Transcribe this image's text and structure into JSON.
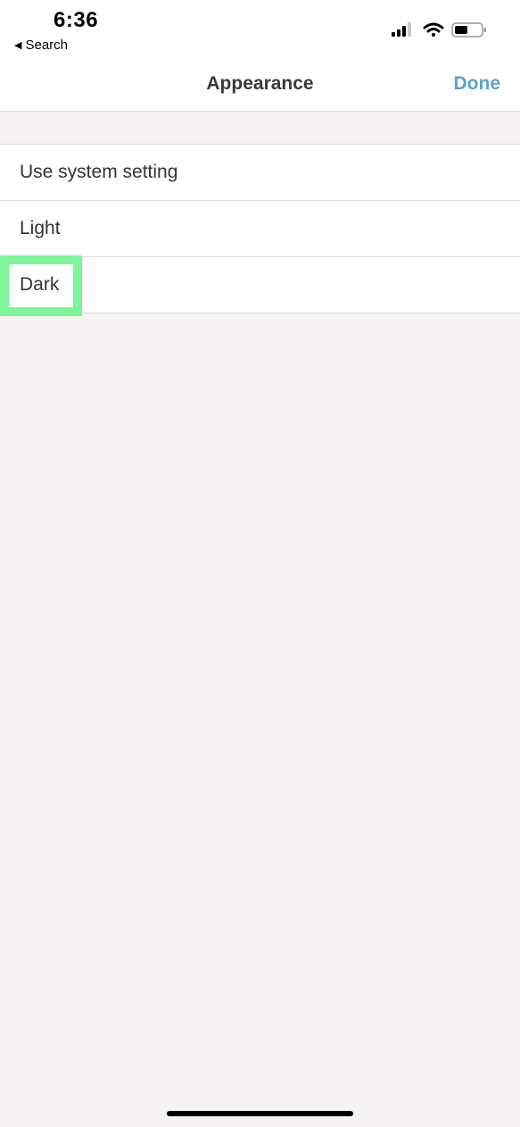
{
  "status_bar": {
    "time": "6:36",
    "back_label": "Search",
    "icons": [
      "signal-icon",
      "wifi-icon",
      "battery-icon"
    ]
  },
  "nav": {
    "title": "Appearance",
    "done_label": "Done"
  },
  "options": [
    {
      "label": "Use system setting"
    },
    {
      "label": "Light"
    },
    {
      "label": "Dark"
    }
  ],
  "colors": {
    "accent": "#5aa3c8",
    "highlight": "#7df59a",
    "background": "#f5f4f0"
  }
}
